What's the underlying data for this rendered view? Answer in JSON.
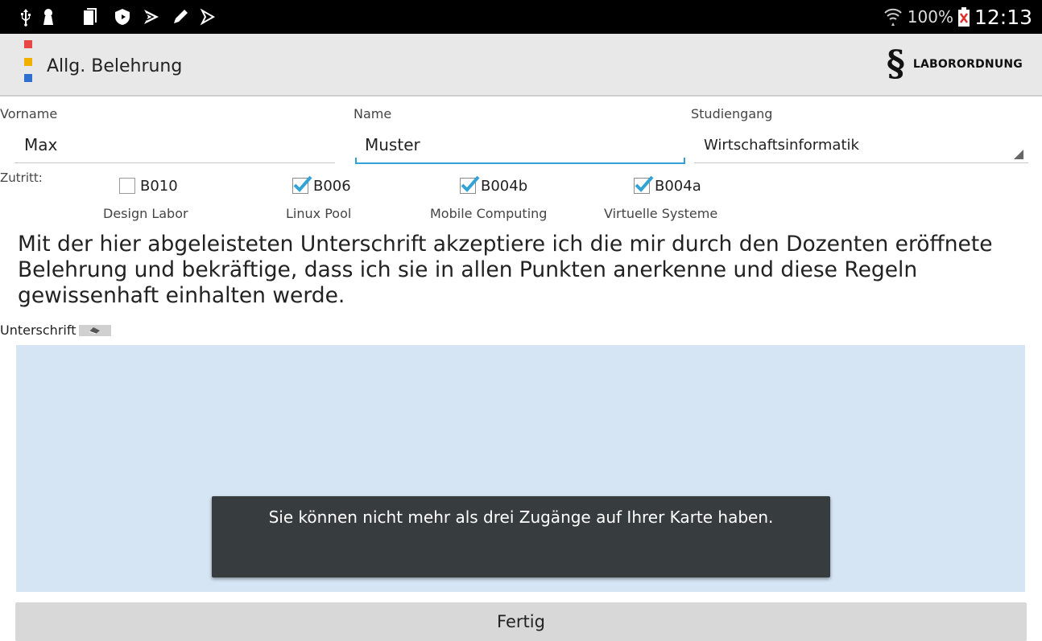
{
  "statusbar": {
    "icons": [
      "usb-icon",
      "keyhole-icon",
      "document-icon",
      "shield-icon",
      "play-store-icon",
      "pen-icon",
      "play-icon"
    ],
    "battery": "100%",
    "time": "12:13"
  },
  "actionbar": {
    "title": "Allg. Belehrung",
    "lab_icon": "§",
    "lab_label": "LABORORDNUNG",
    "logo_colors": [
      "#e84545",
      "#f0b000",
      "#2e6fd0"
    ]
  },
  "form": {
    "firstname": {
      "label": "Vorname",
      "value": "Max"
    },
    "lastname": {
      "label": "Name",
      "value": "Muster"
    },
    "program": {
      "label": "Studiengang",
      "value": "Wirtschaftsinformatik"
    }
  },
  "access": {
    "label": "Zutritt:",
    "rooms": [
      {
        "code": "B010",
        "name": "Design Labor",
        "checked": false
      },
      {
        "code": "B006",
        "name": "Linux Pool",
        "checked": true
      },
      {
        "code": "B004b",
        "name": "Mobile Computing",
        "checked": true
      },
      {
        "code": "B004a",
        "name": "Virtuelle Systeme",
        "checked": true
      }
    ]
  },
  "agreement": "Mit der hier abgeleisteten Unterschrift akzeptiere ich die mir durch den Dozenten eröffnete Belehrung und bekräftige, dass ich sie in allen Punkten anerkenne und diese Regeln gewissenhaft einhalten werde.",
  "signature": {
    "label": "Unterschrift"
  },
  "toast": "Sie können nicht mehr als drei Zugänge auf Ihrer Karte haben.",
  "done_button": "Fertig",
  "colors": {
    "accent": "#33a3d6",
    "check": "#33a3d6",
    "pad": "#d6e5f4",
    "toast": "#373c3f"
  }
}
